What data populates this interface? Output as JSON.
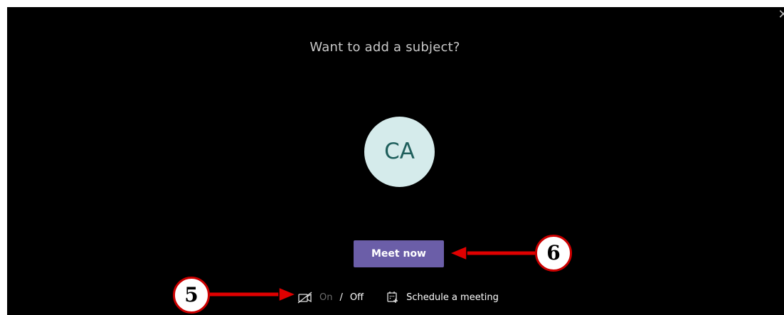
{
  "dialog": {
    "close_icon": "close-icon",
    "subject_prompt": "Want to add a subject?",
    "avatar_initials": "CA",
    "meet_now_label": "Meet now"
  },
  "bottom_bar": {
    "camera_icon": "camera-off-icon",
    "video_on_label": "On",
    "separator": "/",
    "video_off_label": "Off",
    "calendar_icon": "calendar-add-icon",
    "schedule_label": "Schedule a meeting"
  },
  "annotations": [
    {
      "number": "5",
      "points_to": "video-toggle"
    },
    {
      "number": "6",
      "points_to": "meet-now-button"
    }
  ],
  "colors": {
    "background": "#000000",
    "accent_button": "#6b5ea8",
    "avatar_bg": "#d5ebeb",
    "avatar_text": "#1f5f5c",
    "annotation_red": "#cc0000"
  }
}
